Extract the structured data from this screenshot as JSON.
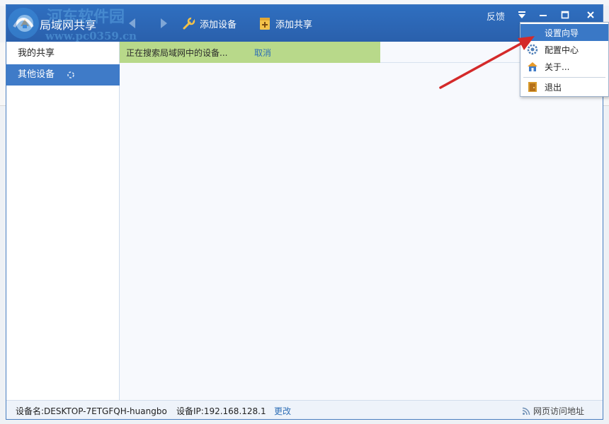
{
  "app": {
    "title": "局域网共享",
    "watermark_line1": "河东软件园",
    "watermark_line2": "www.pc0359.cn"
  },
  "toolbar": {
    "add_device_label": "添加设备",
    "add_share_label": "添加共享",
    "feedback_label": "反馈"
  },
  "sidebar": {
    "items": [
      {
        "label": "我的共享",
        "selected": false
      },
      {
        "label": "其他设备",
        "selected": true
      }
    ]
  },
  "content": {
    "search_status": "正在搜索局域网中的设备...",
    "cancel_label": "取消"
  },
  "statusbar": {
    "device_name": "设备名:DESKTOP-7ETGFQH-huangbo",
    "device_ip": "设备IP:192.168.128.1",
    "change_label": "更改",
    "web_access_label": "网页访问地址"
  },
  "menu": {
    "items": [
      {
        "label": "设置向导",
        "icon": "none",
        "highlighted": true
      },
      {
        "label": "配置中心",
        "icon": "gear-icon",
        "highlighted": false
      },
      {
        "label": "关于...",
        "icon": "home-icon",
        "highlighted": false
      },
      {
        "label": "退出",
        "icon": "exit-door-icon",
        "highlighted": false
      }
    ]
  },
  "colors": {
    "titlebar": "#2c66b4",
    "selected": "#3f7bc8",
    "banner": "#b8d98a",
    "link": "#2f6fb6",
    "annotation": "#d42a2a"
  }
}
